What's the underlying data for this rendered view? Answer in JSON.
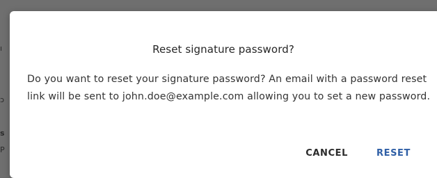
{
  "dialog": {
    "title": "Reset signature password?",
    "message": "Do you want to reset your signature password? An email with a password reset link will be sent to john.doe@example.com allowing you to set a new password.",
    "cancel_label": "CANCEL",
    "reset_label": "RESET"
  },
  "colors": {
    "overlay": "#6f6f6f",
    "dialog_background": "#ffffff",
    "primary_action": "#2f5fa6",
    "secondary_action": "#2b2b2b"
  }
}
